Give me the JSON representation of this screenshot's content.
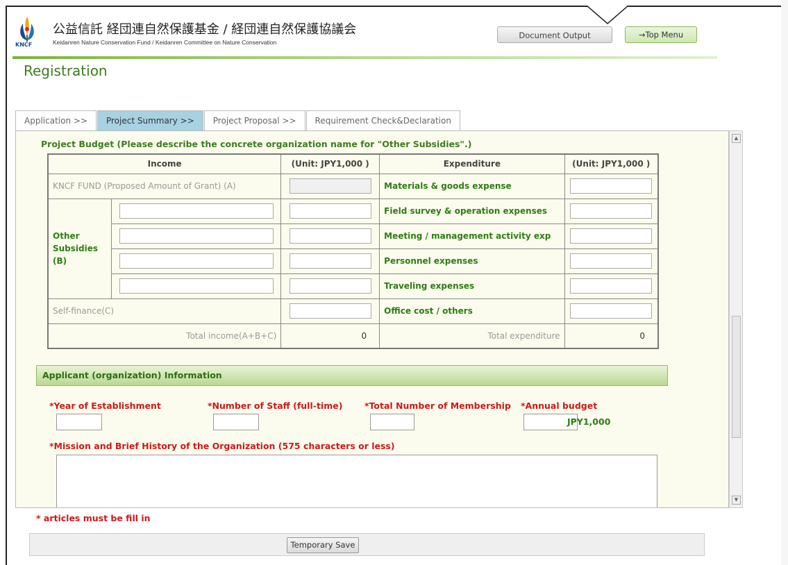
{
  "header": {
    "title_jp": "公益信託 経団連自然保護基金 / 経団連自然保護協議会",
    "title_en": "Keidanren Nature Conservation Fund / Keidanren Committee on Nature Conservation",
    "logo_text": "KNCF",
    "document_output_label": "Document Output",
    "top_menu_label": "→Top Menu"
  },
  "page_title": "Registration",
  "tabs": [
    {
      "label": "Application >>"
    },
    {
      "label": "Project Summary >>"
    },
    {
      "label": "Project Proposal >>"
    },
    {
      "label": "Requirement Check&Declaration"
    }
  ],
  "budget": {
    "title": "Project Budget (Please describe the concrete organization name for \"Other Subsidies\".)",
    "income_header": "Income",
    "income_unit": "(Unit: JPY1,000 )",
    "expenditure_header": "Expenditure",
    "expenditure_unit": "(Unit: JPY1,000 )",
    "kncf_fund": "KNCF FUND (Proposed Amount of Grant) (A)",
    "other_subsidies": "Other Subsidies (B)",
    "self_finance": "Self-finance(C)",
    "total_income_label": "Total income(A+B+C)",
    "total_income_value": "0",
    "total_expenditure_label": "Total expenditure",
    "total_expenditure_value": "0",
    "expenditures": [
      "Materials & goods expense",
      "Field survey & operation expenses",
      "Meeting / management activity exp",
      "Personnel expenses",
      "Traveling expenses",
      "Office cost / others"
    ]
  },
  "applicant": {
    "section_title": "Applicant (organization) Information",
    "year_label": "*Year of Establishment",
    "staff_label": "*Number of Staff (full-time)",
    "membership_label": "*Total Number of Membership",
    "budget_label": "*Annual budget",
    "budget_unit": "JPY1,000",
    "mission_label": "*Mission and Brief History of the Organization (575 characters or less)"
  },
  "footer": {
    "required_note": "* articles must be fill in",
    "temporary_save_label": "Temporary Save"
  },
  "colors": {
    "accent_green": "#3d7c1f",
    "required_red": "#d01818",
    "active_tab": "#a6d2e2"
  }
}
